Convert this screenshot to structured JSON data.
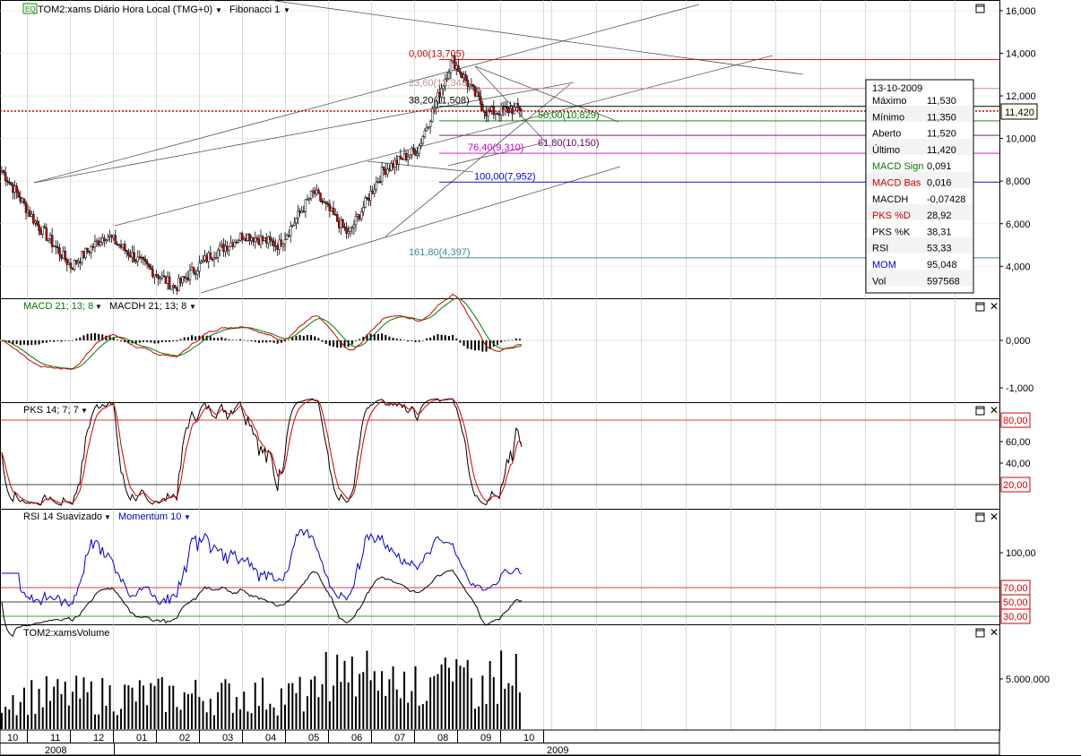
{
  "header": {
    "badge": "EQ",
    "instrument_label": "TOM2:xams Diário Hora Local (TMG+0)",
    "tool_label": "Fibonacci 1"
  },
  "panels": {
    "macd_title": "MACD 21; 13; 8",
    "macdh_title": "MACDH 21; 13; 8",
    "pks_title": "PKS 14; 7; 7",
    "rsi_title": "RSI 14 Suavizado",
    "mom_title": "Momentum 10",
    "vol_title": "TOM2:xamsVolume"
  },
  "data_window": {
    "date": "13-10-2009",
    "rows": [
      {
        "label": "Máximo",
        "value": "11,530",
        "color": "#000000"
      },
      {
        "label": "Mínimo",
        "value": "11,350",
        "color": "#000000"
      },
      {
        "label": "Aberto",
        "value": "11,520",
        "color": "#000000"
      },
      {
        "label": "Último",
        "value": "11,420",
        "color": "#000000"
      },
      {
        "label": "MACD Sign",
        "value": "0,091",
        "color": "#007700"
      },
      {
        "label": "MACD Bas",
        "value": "0,016",
        "color": "#cc0000"
      },
      {
        "label": "MACDH",
        "value": "-0,07428",
        "color": "#000000"
      },
      {
        "label": "PKS %D",
        "value": "28,92",
        "color": "#cc0000"
      },
      {
        "label": "PKS %K",
        "value": "38,31",
        "color": "#000000"
      },
      {
        "label": "RSI",
        "value": "53,33",
        "color": "#000000"
      },
      {
        "label": "MOM",
        "value": "95,048",
        "color": "#0000cc"
      },
      {
        "label": "Vol",
        "value": "597568",
        "color": "#000000"
      }
    ]
  },
  "chart_data": [
    {
      "type": "candlestick",
      "title": "TOM2:xams Diário Hora Local (TMG+0)",
      "x_months": [
        "10",
        "11",
        "12",
        "01",
        "02",
        "03",
        "04",
        "05",
        "06",
        "07",
        "08",
        "09",
        "10"
      ],
      "x_years": [
        "2008",
        "2009"
      ],
      "y_ticks": [
        "16,000",
        "14,000",
        "12,000",
        "10,000",
        "8,000",
        "6,000",
        "4,000"
      ],
      "ylim": [
        2.5,
        16.5
      ],
      "last_price": "11,420",
      "monthly_path": [
        8.5,
        6.0,
        4.0,
        5.5,
        4.2,
        3.0,
        4.5,
        5.5,
        5.0,
        7.5,
        5.5,
        8.5,
        9.5,
        13.7,
        11.2,
        11.42
      ],
      "fibonacci": [
        {
          "label": "0,00(13,705)",
          "value": 13.705,
          "color": "#cc0000"
        },
        {
          "label": "23,60(12,348)",
          "value": 12.348,
          "color": "#c09090"
        },
        {
          "label": "38,20(11,508)",
          "value": 11.508,
          "color": "#000000"
        },
        {
          "label": "50,00(10,829)",
          "value": 10.829,
          "color": "#007700"
        },
        {
          "label": "61,80(10,150)",
          "value": 10.15,
          "color": "#660066"
        },
        {
          "label": "76,40(9,310)",
          "value": 9.31,
          "color": "#cc00cc"
        },
        {
          "label": "100,00(7,952)",
          "value": 7.952,
          "color": "#0000cc"
        },
        {
          "label": "161,80(4,397)",
          "value": 4.397,
          "color": "#3a8a9a"
        }
      ]
    },
    {
      "type": "line",
      "title": "MACD 21; 13; 8",
      "y_ticks": [
        "0,000",
        "-1,000"
      ],
      "series": [
        {
          "name": "MACD 21; 13; 8"
        },
        {
          "name": "MACDH 21; 13; 8"
        }
      ]
    },
    {
      "type": "line",
      "title": "PKS 14; 7; 7",
      "y_ticks": [
        "60,00",
        "40,00"
      ],
      "reference_levels": [
        "80,00",
        "20,00"
      ],
      "series": [
        {
          "name": "PKS 14; 7; 7"
        }
      ]
    },
    {
      "type": "line",
      "title": "RSI 14 Suavizado",
      "y_ticks": [
        "100,00"
      ],
      "reference_levels": [
        "70,00",
        "50,00",
        "30,00"
      ],
      "series": [
        {
          "name": "RSI 14 Suavizado"
        },
        {
          "name": "Momentum 10"
        }
      ]
    },
    {
      "type": "bar",
      "title": "TOM2:xamsVolume",
      "y_ticks": [
        "5.000.000"
      ]
    }
  ],
  "colors": {
    "up_candle": "#ffffff",
    "down_candle": "#cc0000",
    "macd_line": "#cc0000",
    "macd_signal": "#007700",
    "pks_k": "#000000",
    "pks_d": "#cc0000",
    "rsi_line": "#000000",
    "momentum_line": "#0000cc",
    "grid": "#c0c0c0",
    "ref_red": "#cc0000"
  }
}
